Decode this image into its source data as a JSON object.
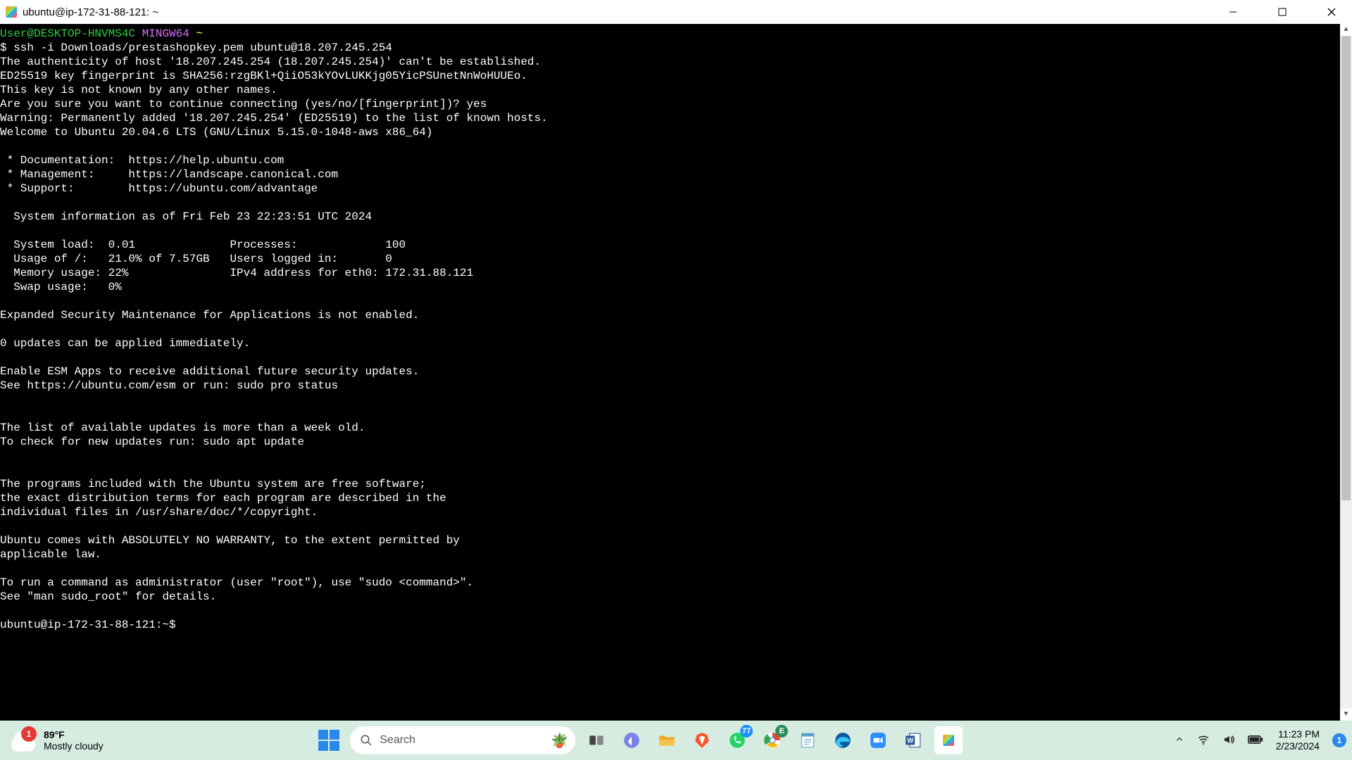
{
  "window": {
    "title": "ubuntu@ip-172-31-88-121: ~"
  },
  "terminal": {
    "prompt_user": "User@DESKTOP-HNVMS4C",
    "prompt_env": "MINGW64",
    "prompt_path": "~",
    "line02": "$ ssh -i Downloads/prestashopkey.pem ubuntu@18.207.245.254",
    "line03": "The authenticity of host '18.207.245.254 (18.207.245.254)' can't be established.",
    "line04": "ED25519 key fingerprint is SHA256:rzgBKl+QiiO53kYOvLUKKjg05YicPSUnetNnWoHUUEo.",
    "line05": "This key is not known by any other names.",
    "line06": "Are you sure you want to continue connecting (yes/no/[fingerprint])? yes",
    "line07": "Warning: Permanently added '18.207.245.254' (ED25519) to the list of known hosts.",
    "line08": "Welcome to Ubuntu 20.04.6 LTS (GNU/Linux 5.15.0-1048-aws x86_64)",
    "line10": " * Documentation:  https://help.ubuntu.com",
    "line11": " * Management:     https://landscape.canonical.com",
    "line12": " * Support:        https://ubuntu.com/advantage",
    "line14": "  System information as of Fri Feb 23 22:23:51 UTC 2024",
    "line16": "  System load:  0.01              Processes:             100",
    "line17": "  Usage of /:   21.0% of 7.57GB   Users logged in:       0",
    "line18": "  Memory usage: 22%               IPv4 address for eth0: 172.31.88.121",
    "line19": "  Swap usage:   0%",
    "line21": "Expanded Security Maintenance for Applications is not enabled.",
    "line23": "0 updates can be applied immediately.",
    "line25": "Enable ESM Apps to receive additional future security updates.",
    "line26": "See https://ubuntu.com/esm or run: sudo pro status",
    "line29": "The list of available updates is more than a week old.",
    "line30": "To check for new updates run: sudo apt update",
    "line33": "The programs included with the Ubuntu system are free software;",
    "line34": "the exact distribution terms for each program are described in the",
    "line35": "individual files in /usr/share/doc/*/copyright.",
    "line37": "Ubuntu comes with ABSOLUTELY NO WARRANTY, to the extent permitted by",
    "line38": "applicable law.",
    "line40": "To run a command as administrator (user \"root\"), use \"sudo <command>\".",
    "line41": "See \"man sudo_root\" for details.",
    "line43": "ubuntu@ip-172-31-88-121:~$"
  },
  "taskbar": {
    "weather_badge": "1",
    "temp": "89°F",
    "condition": "Mostly cloudy",
    "search_placeholder": "Search",
    "whatsapp_badge": "77",
    "browser_badge": "E",
    "time": "11:23 PM",
    "date": "2/23/2024",
    "notif_count": "1"
  }
}
